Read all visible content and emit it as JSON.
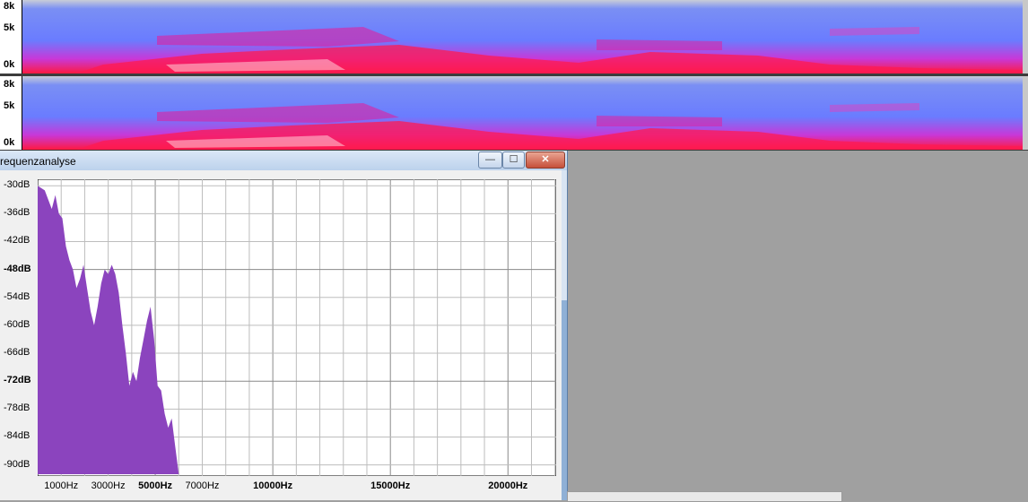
{
  "tracks": [
    {
      "labels": [
        "8k",
        "5k",
        "0k"
      ]
    },
    {
      "labels": [
        "8k",
        "5k",
        "0k"
      ]
    }
  ],
  "dialog": {
    "title": "requenzanalyse",
    "buttons": {
      "minimize": "—",
      "maximize": "☐",
      "close": "✕"
    }
  },
  "colors": {
    "spectrum_fill": "#8b44be",
    "grid": "#bdbdbd",
    "spectrogram_base": "#6e8cff",
    "spectrogram_hot": "#ff1040"
  },
  "chart_data": {
    "type": "area",
    "y_ticks": [
      {
        "label": "-30dB",
        "bold": false
      },
      {
        "label": "-36dB",
        "bold": false
      },
      {
        "label": "-42dB",
        "bold": false
      },
      {
        "label": "-48dB",
        "bold": true
      },
      {
        "label": "-54dB",
        "bold": false
      },
      {
        "label": "-60dB",
        "bold": false
      },
      {
        "label": "-66dB",
        "bold": false
      },
      {
        "label": "-72dB",
        "bold": true
      },
      {
        "label": "-78dB",
        "bold": false
      },
      {
        "label": "-84dB",
        "bold": false
      },
      {
        "label": "-90dB",
        "bold": false
      }
    ],
    "x_ticks": [
      {
        "label": "1000Hz",
        "value": 1000,
        "bold": false
      },
      {
        "label": "3000Hz",
        "value": 3000,
        "bold": false
      },
      {
        "label": "5000Hz",
        "value": 5000,
        "bold": true
      },
      {
        "label": "7000Hz",
        "value": 7000,
        "bold": false
      },
      {
        "label": "10000Hz",
        "value": 10000,
        "bold": true
      },
      {
        "label": "15000Hz",
        "value": 15000,
        "bold": true
      },
      {
        "label": "20000Hz",
        "value": 20000,
        "bold": true
      }
    ],
    "xlim": [
      0,
      22050
    ],
    "ylim": [
      -92,
      -29
    ],
    "grid": true,
    "x": [
      0,
      150,
      300,
      450,
      600,
      750,
      900,
      1050,
      1200,
      1350,
      1500,
      1650,
      1800,
      1950,
      2100,
      2250,
      2400,
      2550,
      2700,
      2850,
      3000,
      3150,
      3300,
      3450,
      3600,
      3750,
      3900,
      4050,
      4200,
      4350,
      4500,
      4650,
      4800,
      4950,
      5100,
      5250,
      5400,
      5550,
      5700,
      5850,
      6000
    ],
    "y": [
      -30,
      -30.5,
      -31,
      -33,
      -35,
      -32,
      -36,
      -37,
      -43,
      -46,
      -48,
      -52,
      -50,
      -47,
      -52,
      -57,
      -60,
      -56,
      -51,
      -48,
      -49,
      -47,
      -49,
      -53,
      -60,
      -66,
      -73,
      -70,
      -72,
      -67,
      -63,
      -59,
      -56,
      -63,
      -73,
      -74,
      -79,
      -82,
      -80,
      -86,
      -92
    ]
  }
}
